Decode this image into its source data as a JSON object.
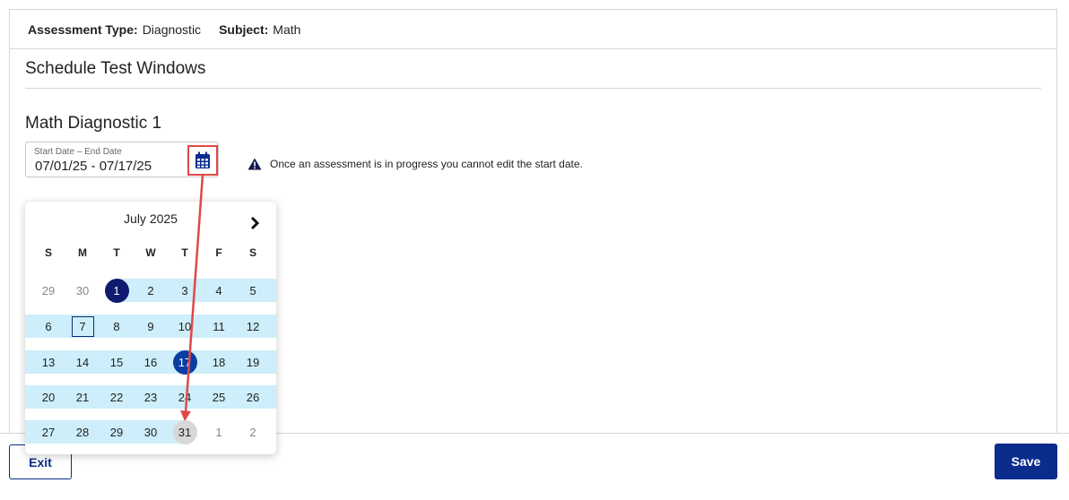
{
  "header": {
    "assessment_type_label": "Assessment Type:",
    "assessment_type_value": "Diagnostic",
    "subject_label": "Subject:",
    "subject_value": "Math"
  },
  "section_title": "Schedule Test Windows",
  "test_window": {
    "title": "Math Diagnostic 1",
    "date_field_label": "Start Date – End Date",
    "date_field_value": "07/01/25 - 07/17/25",
    "calendar_icon": "calendar-icon"
  },
  "notice": {
    "icon": "warning-icon",
    "text": "Once an assessment is in progress you cannot edit the start date."
  },
  "datepicker": {
    "month_label": "July 2025",
    "next_icon": "chevron-right-icon",
    "weekdays": [
      "S",
      "M",
      "T",
      "W",
      "T",
      "F",
      "S"
    ],
    "weeks": [
      [
        "29",
        "30",
        "1",
        "2",
        "3",
        "4",
        "5"
      ],
      [
        "6",
        "7",
        "8",
        "9",
        "10",
        "11",
        "12"
      ],
      [
        "13",
        "14",
        "15",
        "16",
        "17",
        "18",
        "19"
      ],
      [
        "20",
        "21",
        "22",
        "23",
        "24",
        "25",
        "26"
      ],
      [
        "27",
        "28",
        "29",
        "30",
        "31",
        "1",
        "2"
      ]
    ],
    "range_start": "1",
    "range_end": "17",
    "today": "7",
    "hovered": "31"
  },
  "footer": {
    "exit_label": "Exit",
    "save_label": "Save"
  },
  "colors": {
    "primary": "#0a2c8c",
    "range_bg": "#cdeefa",
    "selected_start": "#101a6e",
    "selected_end": "#0a3ea3",
    "annotation": "#e04848"
  }
}
